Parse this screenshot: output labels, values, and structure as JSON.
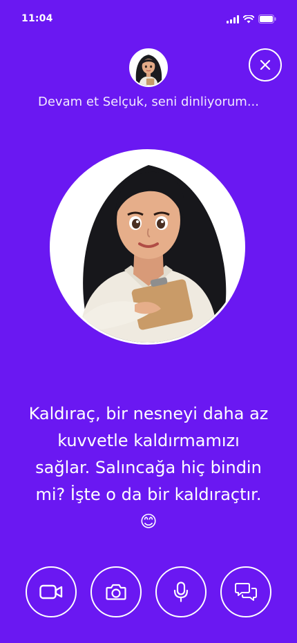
{
  "status_bar": {
    "time": "11:04",
    "icons": [
      "signal-icon",
      "wifi-icon",
      "battery-icon"
    ]
  },
  "header": {
    "avatar": "assistant-avatar-small",
    "close_icon": "close-icon",
    "listening_text": "Devam et Selçuk, seni dinliyorum..."
  },
  "main": {
    "avatar": "assistant-avatar-large",
    "message": "Kaldıraç, bir nesneyi daha az kuvvetle kaldırmamızı sağlar. Salıncağa hiç bindin mi? İşte o da bir kaldıraçtır. 😊"
  },
  "controls": [
    {
      "icon": "video-camera-icon"
    },
    {
      "icon": "camera-icon"
    },
    {
      "icon": "microphone-icon"
    },
    {
      "icon": "chat-bubbles-icon"
    }
  ],
  "colors": {
    "background": "#6a18f2",
    "foreground": "#ffffff"
  }
}
